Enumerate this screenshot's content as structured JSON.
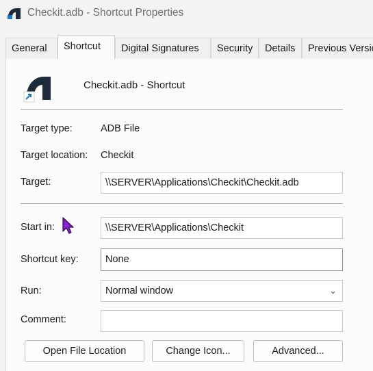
{
  "window": {
    "title": "Checkit.adb - Shortcut Properties"
  },
  "tabs": [
    {
      "label": "General",
      "active": false
    },
    {
      "label": "Shortcut",
      "active": true
    },
    {
      "label": "Digital Signatures",
      "active": false
    },
    {
      "label": "Security",
      "active": false
    },
    {
      "label": "Details",
      "active": false
    },
    {
      "label": "Previous Versions",
      "active": false
    }
  ],
  "header": {
    "name": "Checkit.adb - Shortcut"
  },
  "fields": {
    "target_type": {
      "label": "Target type:",
      "value": "ADB File"
    },
    "target_location": {
      "label": "Target location:",
      "value": "Checkit"
    },
    "target": {
      "label": "Target:",
      "value": "\\\\SERVER\\Applications\\Checkit\\Checkit.adb"
    },
    "start_in": {
      "label": "Start in:",
      "value": "\\\\SERVER\\Applications\\Checkit"
    },
    "shortcut_key": {
      "label": "Shortcut key:",
      "value": "None"
    },
    "run": {
      "label": "Run:",
      "value": "Normal window"
    },
    "comment": {
      "label": "Comment:",
      "value": ""
    }
  },
  "buttons": {
    "open_file_location": "Open File Location",
    "change_icon": "Change Icon...",
    "advanced": "Advanced..."
  },
  "icons": {
    "app": "app-logo-icon",
    "shortcut_arrow": "shortcut-arrow-icon",
    "cursor": "mouse-pointer-icon"
  },
  "colors": {
    "logo_dark": "#1d2a3a",
    "shortcut_arrow": "#1a73c8",
    "cursor": "#8a1fd6"
  }
}
